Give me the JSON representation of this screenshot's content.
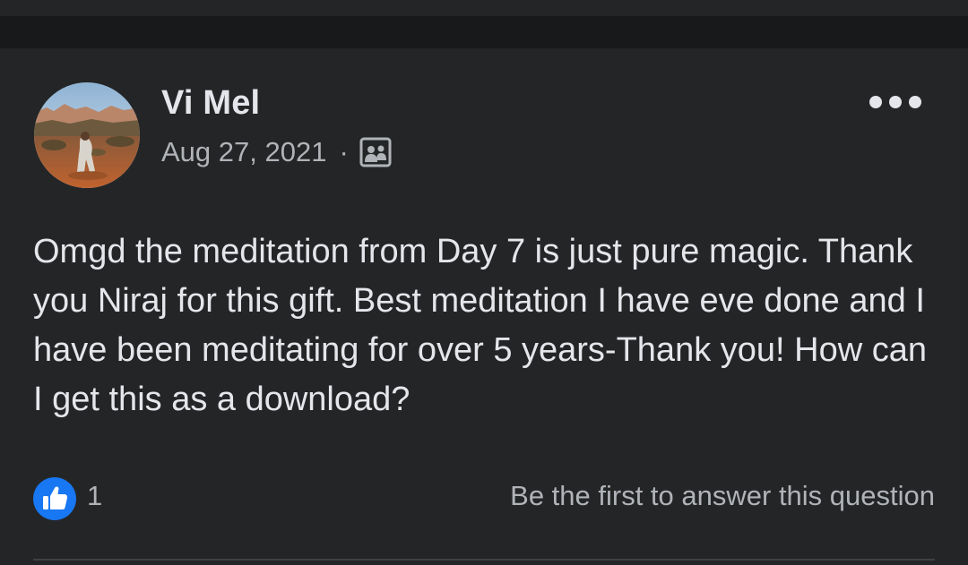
{
  "post": {
    "author": "Vi Mel",
    "date": "Aug 27, 2021",
    "separator": "·",
    "audience_icon": "group-icon",
    "more_icon": "more-horizontal-icon",
    "body": "Omgd the meditation from Day 7 is just pure magic. Thank you Niraj for this gift. Best meditation I have eve done and I have been meditating for over 5 years-Thank you! How can I get this as a download?",
    "reactions": {
      "icon": "like-icon",
      "count": "1"
    },
    "answer_link": "Be the first to answer this question"
  },
  "colors": {
    "background": "#242526",
    "band": "#18191a",
    "primary_text": "#e4e6eb",
    "secondary_text": "#b0b3b8",
    "like_blue": "#1877f2"
  }
}
